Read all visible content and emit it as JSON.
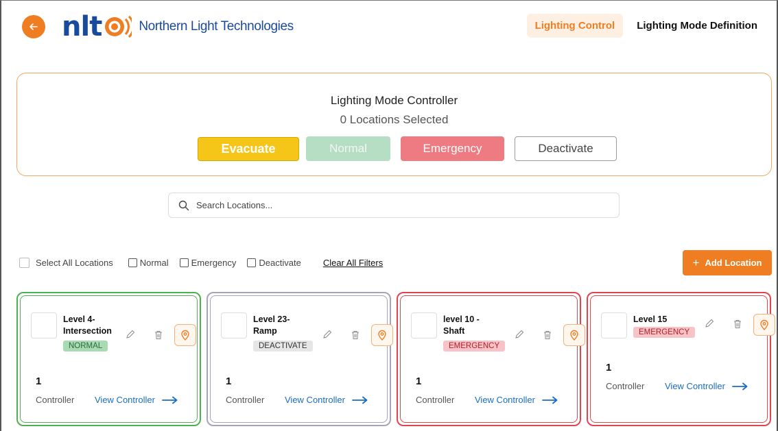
{
  "header": {
    "logo_mark": "nlt",
    "company_name": "Northern Light Technologies",
    "nav": [
      {
        "label": "Lighting Control",
        "active": true
      },
      {
        "label": "Lighting Mode Definition",
        "active": false
      }
    ],
    "back_icon": "arrow-left-icon"
  },
  "controller_panel": {
    "title": "Lighting Mode Controller",
    "selected_text": "0 Locations Selected",
    "modes": {
      "evacuate": "Evacuate",
      "normal": "Normal",
      "emergency": "Emergency",
      "deactivate": "Deactivate"
    }
  },
  "search": {
    "placeholder": "Search Locations..."
  },
  "filters": {
    "select_all": "Select All Locations",
    "normal": "Normal",
    "emergency": "Emergency",
    "deactivate": "Deactivate",
    "clear": "Clear All Filters"
  },
  "add_location": {
    "plus": "+",
    "label": "Add Location"
  },
  "locations": [
    {
      "name": "Level 4-\nIntersection",
      "status": "NORMAL",
      "count": "1",
      "count_label": "Controller",
      "link": "View Controller"
    },
    {
      "name": "Level 23-\nRamp",
      "status": "DEACTIVATE",
      "count": "1",
      "count_label": "Controller",
      "link": "View Controller"
    },
    {
      "name": "level 10 -\nShaft",
      "status": "EMERGENCY",
      "count": "1",
      "count_label": "Controller",
      "link": "View Controller"
    },
    {
      "name": "Level 15",
      "status": "EMERGENCY",
      "count": "1",
      "count_label": "Controller",
      "link": "View Controller"
    }
  ],
  "colors": {
    "accent": "#ef7d22",
    "brand_blue": "#1a4a9c",
    "evacuate": "#f5c518",
    "normal": "#b6dec4",
    "emergency": "#ee7b82",
    "link": "#1a6cc4",
    "card_normal": "#4caf50",
    "card_deactivate": "#a4a3ba",
    "card_emergency": "#e0454e"
  }
}
